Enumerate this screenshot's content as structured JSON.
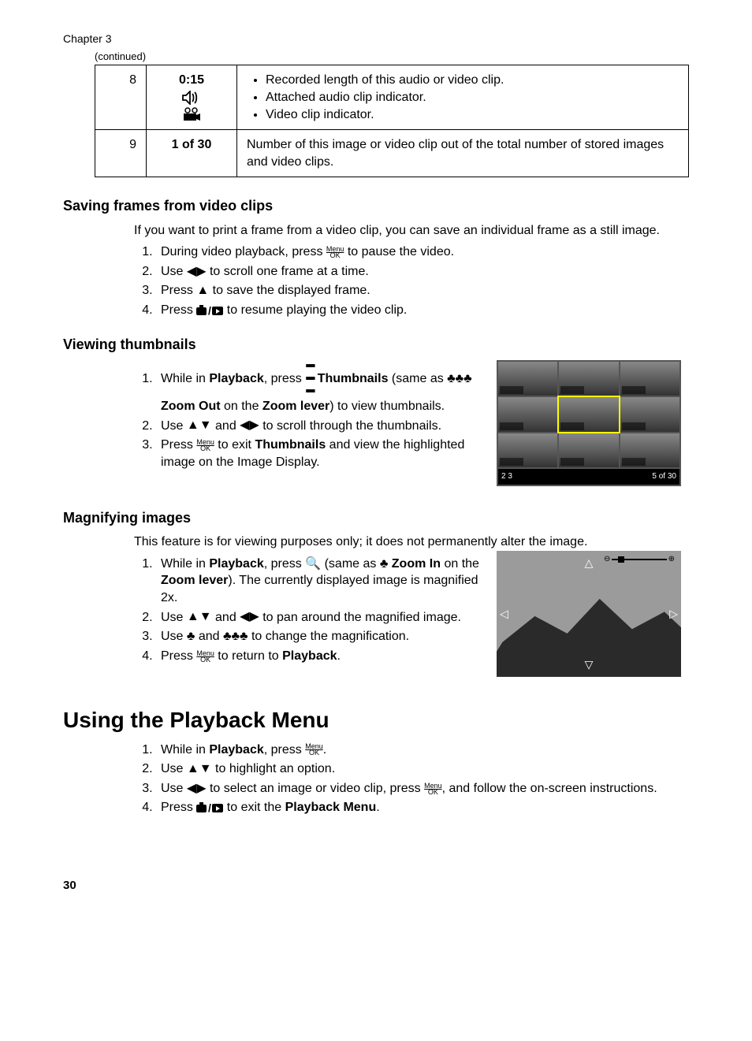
{
  "chapter": "Chapter 3",
  "continued": "(continued)",
  "table": {
    "row8": {
      "num": "8",
      "label": "0:15",
      "bullets": [
        "Recorded length of this audio or video clip.",
        "Attached audio clip indicator.",
        "Video clip indicator."
      ]
    },
    "row9": {
      "num": "9",
      "label": "1 of 30",
      "desc": "Number of this image or video clip out of the total number of stored images and video clips."
    }
  },
  "saving": {
    "heading": "Saving frames from video clips",
    "intro": "If you want to print a frame from a video clip, you can save an individual frame as a still image.",
    "step1_a": "During video playback, press ",
    "step1_b": " to pause the video.",
    "step2_a": "Use ",
    "step2_b": " to scroll one frame at a time.",
    "step3_a": "Press ",
    "step3_b": " to save the displayed frame.",
    "step4_a": "Press ",
    "step4_b": " to resume playing the video clip."
  },
  "thumbs": {
    "heading": "Viewing thumbnails",
    "step1_a": "While in ",
    "step1_b": "Playback",
    "step1_c": ", press ",
    "step1_d": "Thumbnails",
    "step1_e": " (same as ",
    "step1_f": "Zoom Out",
    "step1_g": " on the ",
    "step1_h": "Zoom lever",
    "step1_i": ") to view thumbnails.",
    "step2_a": "Use ",
    "step2_b": " and ",
    "step2_c": " to scroll through the thumbnails.",
    "step3_a": "Press ",
    "step3_b": " to exit ",
    "step3_c": "Thumbnails",
    "step3_d": " and view the highlighted image on the Image Display.",
    "status_left": "2   3",
    "status_right": "5 of 30"
  },
  "magnify": {
    "heading": "Magnifying images",
    "intro": "This feature is for viewing purposes only; it does not permanently alter the image.",
    "step1_a": "While in ",
    "step1_b": "Playback",
    "step1_c": ", press ",
    "step1_d": " (same as ",
    "step1_e": "Zoom In",
    "step1_f": " on the ",
    "step1_g": "Zoom lever",
    "step1_h": "). The currently displayed image is magnified 2x.",
    "step2_a": "Use ",
    "step2_b": " and ",
    "step2_c": " to pan around the magnified image.",
    "step3_a": "Use ",
    "step3_b": " and ",
    "step3_c": " to change the magnification.",
    "step4_a": "Press ",
    "step4_b": " to return to ",
    "step4_c": "Playback",
    "step4_d": "."
  },
  "playback_menu": {
    "heading": "Using the Playback Menu",
    "step1_a": "While in ",
    "step1_b": "Playback",
    "step1_c": ", press ",
    "step1_d": ".",
    "step2_a": "Use ",
    "step2_b": " to highlight an option.",
    "step3_a": "Use ",
    "step3_b": " to select an image or video clip, press ",
    "step3_c": ", and follow the on-screen instructions.",
    "step4_a": "Press ",
    "step4_b": " to exit the ",
    "step4_c": "Playback Menu",
    "step4_d": "."
  },
  "page_number": "30"
}
